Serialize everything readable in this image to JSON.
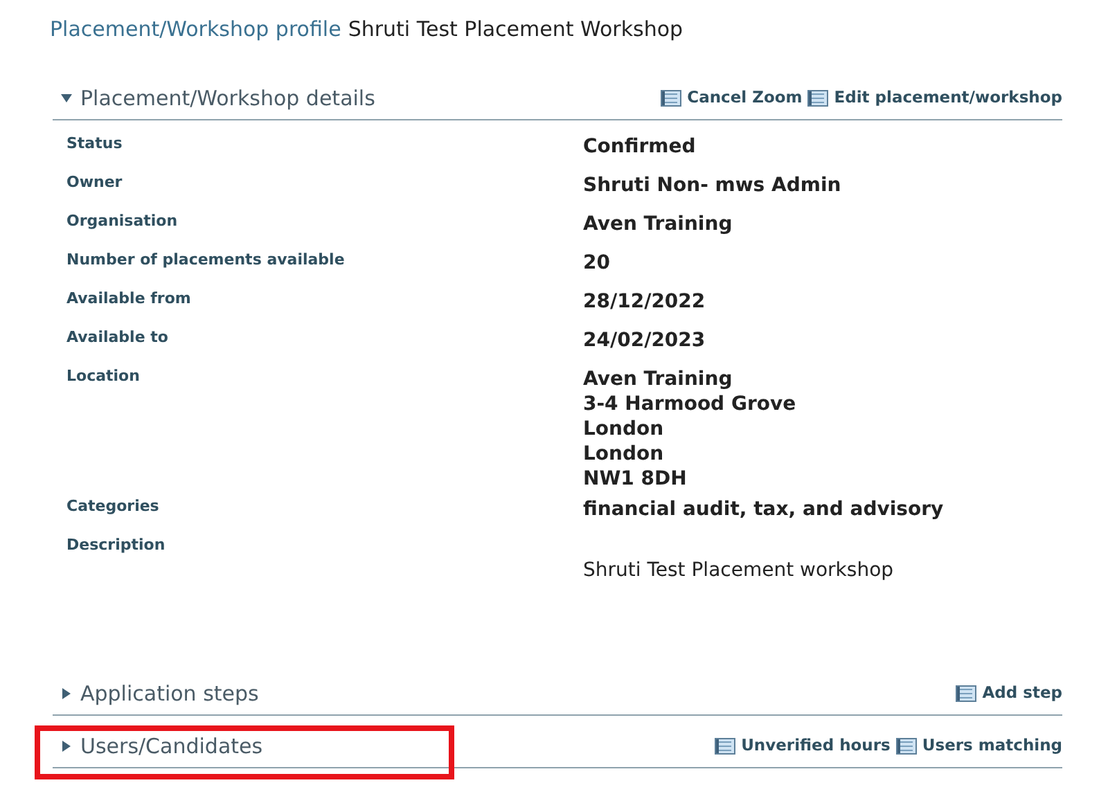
{
  "page_title": {
    "prefix": "Placement/Workshop profile",
    "name": "Shruti Test Placement Workshop"
  },
  "sections": [
    {
      "title": "Placement/Workshop details",
      "expanded": true,
      "highlighted": false,
      "actions": [
        "Cancel Zoom",
        "Edit placement/workshop"
      ],
      "fields": [
        {
          "label": "Status",
          "kind": "plain",
          "lines": [
            "Confirmed"
          ]
        },
        {
          "label": "Owner",
          "kind": "plain",
          "lines": [
            "Shruti Non- mws Admin"
          ]
        },
        {
          "label": "Organisation",
          "kind": "plain",
          "lines": [
            "Aven Training"
          ]
        },
        {
          "label": "Number of placements available",
          "kind": "plain",
          "lines": [
            "20"
          ]
        },
        {
          "label": "Available from",
          "kind": "plain",
          "lines": [
            "28/12/2022"
          ]
        },
        {
          "label": "Available to",
          "kind": "plain",
          "lines": [
            "24/02/2023"
          ]
        },
        {
          "label": "Location",
          "kind": "plain",
          "lines": [
            "Aven Training",
            "3-4 Harmood Grove",
            "London",
            "London",
            "NW1 8DH"
          ]
        },
        {
          "label": "Categories",
          "kind": "plain",
          "lines": [
            "financial audit, tax, and advisory"
          ]
        },
        {
          "label": "Description",
          "kind": "paragraph",
          "lines": [
            "Shruti Test Placement workshop"
          ]
        }
      ]
    },
    {
      "title": "Application steps",
      "expanded": false,
      "highlighted": false,
      "actions": [
        "Add step"
      ]
    },
    {
      "title": "Users/Candidates",
      "expanded": false,
      "highlighted": true,
      "actions": [
        "Unverified hours",
        "Users matching"
      ]
    }
  ]
}
